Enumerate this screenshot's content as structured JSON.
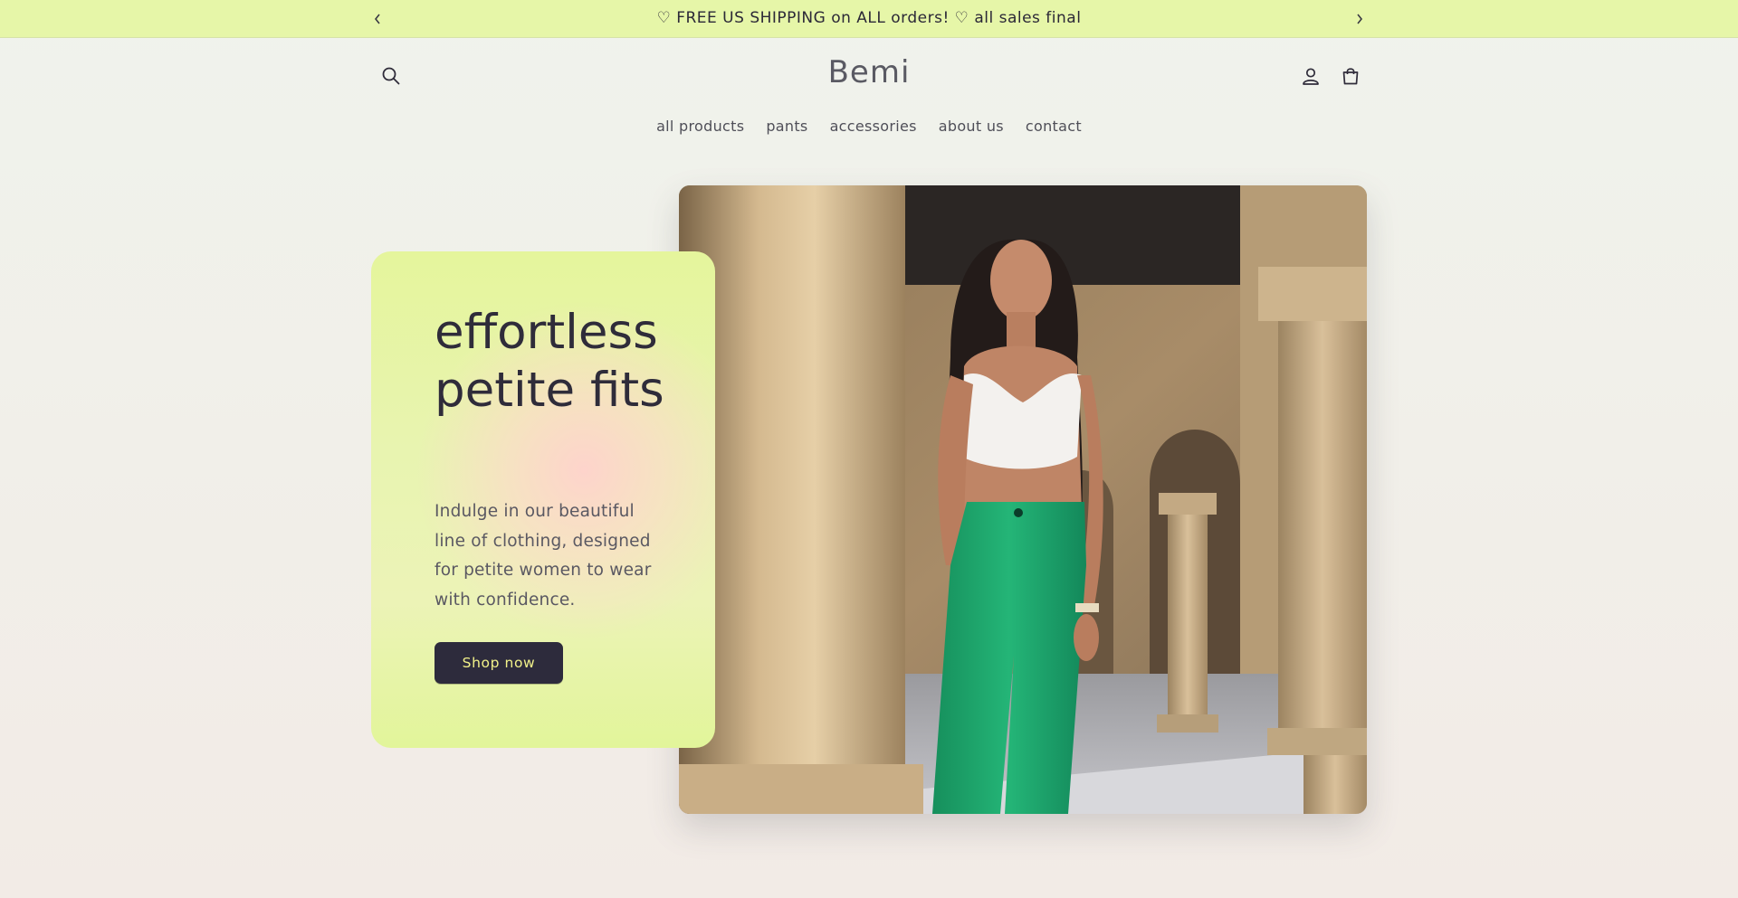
{
  "announcement": {
    "text": "♡ FREE US SHIPPING on ALL orders! ♡ all sales final",
    "prev_icon": "chevron-left-icon",
    "next_icon": "chevron-right-icon"
  },
  "header": {
    "logo": "Bemi",
    "search_icon": "search-icon",
    "account_icon": "account-icon",
    "cart_icon": "cart-icon"
  },
  "nav": {
    "items": [
      {
        "label": "all products"
      },
      {
        "label": "pants"
      },
      {
        "label": "accessories"
      },
      {
        "label": "about us"
      },
      {
        "label": "contact"
      }
    ]
  },
  "hero": {
    "title": "effortless petite fits",
    "subtitle": "Indulge in our beautiful line of clothing, designed for petite women to wear with confidence.",
    "cta_label": "Shop now"
  },
  "colors": {
    "announcement_bg": "#e6f6a8",
    "button_bg": "#2d2b3c",
    "button_text": "#f2f28a",
    "card_green": "#e5f59c",
    "card_pink": "#ffd2cd"
  }
}
